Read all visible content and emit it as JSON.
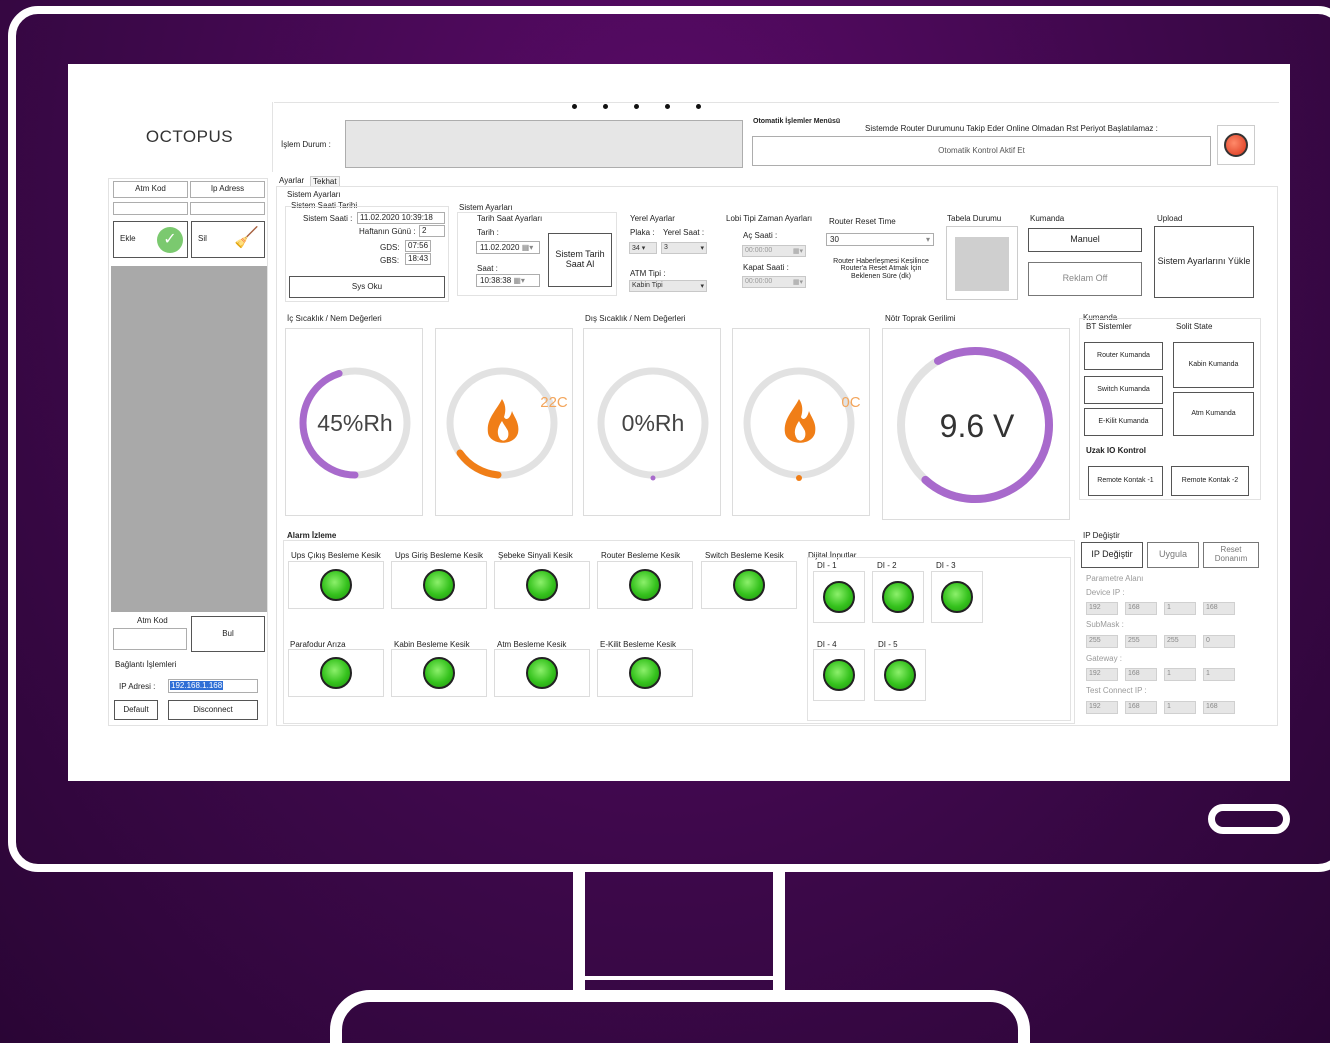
{
  "app": {
    "title": "OCTOPUS",
    "islem_durum_label": "İşlem Durum :",
    "otomatik_menu_label": "Otomatik İşlemler Menüsü",
    "router_status_text": "Sistemde Router Durumunu Takip Eder Online Olmadan Rst Periyot Başlatılamaz :",
    "otomatik_kontrol_button": "Otomatik Kontrol Aktif Et"
  },
  "left": {
    "col_atm_kod": "Atm Kod",
    "col_ip_adres": "Ip Adress",
    "ekle": "Ekle",
    "sil": "Sil",
    "atm_kod_label": "Atm Kod",
    "bul": "Bul",
    "baglanti_label": "Bağlantı İşlemleri",
    "ip_adresi_label": "IP Adresi :",
    "ip_value": "192.168.1.168",
    "default": "Default",
    "disconnect": "Disconnect"
  },
  "tabs": [
    "Ayarlar",
    "Tekhat"
  ],
  "sistem_ayarlari": {
    "title": "Sistem Ayarları",
    "sub": "Sistem Saati Tarihi",
    "sistem_saati_label": "Sistem Saati :",
    "sistem_saati_value": "11.02.2020  10:39:18",
    "haftanin_gunu_label": "Haftanın Günü :",
    "haftanin_gunu_value": "2",
    "gds_label": "GDS:",
    "gds_value": "07:56",
    "gbs_label": "GBS:",
    "gbs_value": "18:43",
    "sys_oku": "Sys Oku"
  },
  "sistem_ayarlari2": {
    "title": "Sistem Ayarları",
    "tarih_saat": "Tarih Saat Ayarları",
    "tarih_label": "Tarih :",
    "tarih_value": "11.02.2020",
    "saat_label": "Saat :",
    "saat_value": "10:38:38",
    "sistem_tarih_btn": "Sistem Tarih Saat Al"
  },
  "yerel": {
    "title": "Yerel Ayarlar",
    "plaka_label": "Plaka :",
    "yerel_saat_label": "Yerel Saat :",
    "plaka_value": "34",
    "yerel_saat_value": "3",
    "atm_tipi_label": "ATM Tipi :",
    "atm_tipi_value": "Kabin Tipi"
  },
  "lobi": {
    "title": "Lobi Tipi Zaman Ayarları",
    "ac_label": "Aç Saati :",
    "ac_value": "00:00:00",
    "kapat_label": "Kapat Saati :",
    "kapat_value": "00:00:00"
  },
  "router_reset": {
    "title": "Router Reset Time",
    "value": "30",
    "desc": "Router Haberleşmesi Kesilince Router'a Reset Atmak İçin Beklenen Süre (dk)"
  },
  "tabela": {
    "title": "Tabela Durumu"
  },
  "kumanda_top": {
    "title": "Kumanda",
    "manuel": "Manuel",
    "reklam": "Reklam Off"
  },
  "upload": {
    "title": "Upload",
    "button": "Sistem Ayarlarını Yükle"
  },
  "ic_sicaklik": {
    "title": "İç Sıcaklık / Nem Değerleri",
    "nem": "45%Rh",
    "sicaklik": "22C"
  },
  "dis_sicaklik": {
    "title": "Dış Sıcaklık / Nem Değerleri",
    "nem": "0%Rh",
    "sicaklik": "0C"
  },
  "notr": {
    "title": "Nötr Toprak Gerilimi",
    "value": "9.6 V"
  },
  "gauges": {
    "ic_nem_fraction": 0.45,
    "notr_fraction": 0.7
  },
  "kumanda": {
    "title": "Kumanda",
    "bt_title": "BT Sistemler",
    "solid_title": "Solit State",
    "router": "Router Kumanda",
    "switch": "Switch Kumanda",
    "ekilit": "E-Kilit Kumanda",
    "kabin": "Kabin Kumanda",
    "atm": "Atm Kumanda",
    "uzak_title": "Uzak IO Kontrol",
    "remote1": "Remote Kontak -1",
    "remote2": "Remote Kontak -2"
  },
  "alarm": {
    "title": "Alarm İzleme",
    "items": [
      "Ups Çıkış Besleme Kesik",
      "Ups Giriş Besleme Kesik",
      "Şebeke Sinyali Kesik",
      "Router Besleme Kesik",
      "Switch Besleme Kesik",
      "Parafodur Arıza",
      "Kabin Besleme Kesik",
      "Atm Besleme Kesik",
      "E-Kilit Besleme Kesik"
    ]
  },
  "dijital": {
    "title": "Dijital İnputlar",
    "items": [
      "DI - 1",
      "DI - 2",
      "DI - 3",
      "DI - 4",
      "DI - 5"
    ]
  },
  "ip_degistir": {
    "title": "IP Değiştir",
    "btn_degistir": "IP Değiştir",
    "btn_uygula": "Uygula",
    "btn_reset": "Reset Donanım",
    "param_label": "Parametre Alanı",
    "device_ip_label": "Device IP :",
    "device_ip": [
      "192",
      "168",
      "1",
      "168"
    ],
    "submask_label": "SubMask :",
    "submask": [
      "255",
      "255",
      "255",
      "0"
    ],
    "gateway_label": "Gateway :",
    "gateway": [
      "192",
      "168",
      "1",
      "1"
    ],
    "test_label": "Test Connect IP :",
    "test_ip": [
      "192",
      "168",
      "1",
      "168"
    ]
  }
}
